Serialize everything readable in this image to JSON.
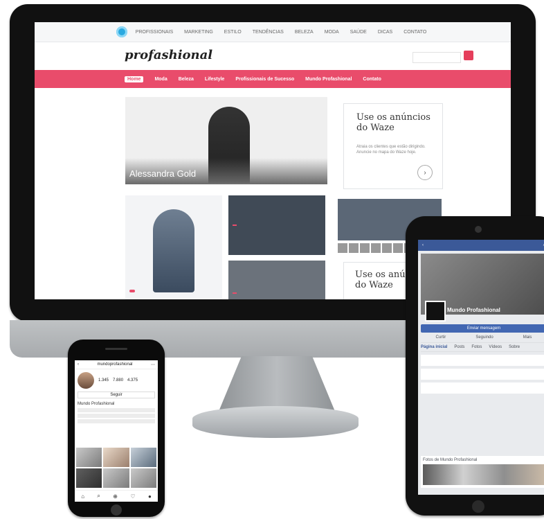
{
  "monitor": {
    "top_nav": [
      "PROFISSIONAIS",
      "MARKETING",
      "ESTILO",
      "TENDÊNCIAS",
      "BELEZA",
      "MODA",
      "SAÚDE",
      "DICAS",
      "CONTATO"
    ],
    "brand": "profashional",
    "menu_items": [
      "Home",
      "Moda",
      "Beleza",
      "Lifestyle",
      "Profissionais de Sucesso",
      "Mundo Profashional",
      "Contato"
    ],
    "hero_caption": "Alessandra Gold",
    "ad_title": "Use os anúncios do Waze",
    "ad_body": "Atraia os clientes que estão dirigindo. Anuncie no mapa do Waze hoje.",
    "ad_arrow": "›",
    "feature_left_tag": "",
    "card_mid_tag": "",
    "card_mid_text": "",
    "card_mid2_tag": "",
    "ad2_title": "Use os anúncios do Waze"
  },
  "tablet": {
    "fb_page_name": "Mundo Profashional",
    "fb_category": "",
    "fb_send_label": "Enviar mensagem",
    "fb_actions": [
      "Curtir",
      "Seguindo",
      "Mais"
    ],
    "fb_tabs": [
      "Página inicial",
      "Posts",
      "Fotos",
      "Vídeos",
      "Sobre"
    ],
    "fb_photos_title": "Fotos de Mundo Profashional"
  },
  "phone": {
    "ig_username": "mundoprofashional",
    "ig_posts": "1.345",
    "ig_followers": "7.880",
    "ig_following": "4.375",
    "ig_edit_label": "Seguir",
    "ig_bio_name": "Mundo Profashional"
  },
  "icons": {
    "site_logo": "circle-logo-icon",
    "search": "search-icon",
    "arrow": "arrow-right-icon",
    "home": "home-icon",
    "instagram_grid": "grid-icon"
  }
}
